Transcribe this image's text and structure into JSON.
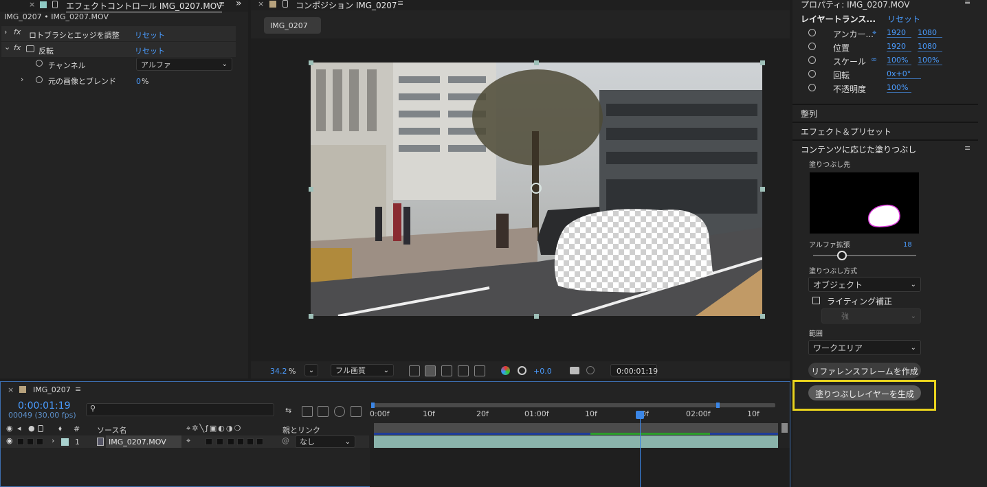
{
  "effect_panel": {
    "tab_label": "エフェクトコントロール IMG_0207.MOV",
    "breadcrumb": "IMG_0207 • IMG_0207.MOV",
    "rows": [
      {
        "fx": "fx",
        "label": "ロトブラシとエッジを調整",
        "value": "リセット"
      },
      {
        "fx": "fx",
        "label": "反転",
        "value": "リセット"
      }
    ],
    "channel_label": "チャンネル",
    "channel_value": "アルファ",
    "blend_label": "元の画像とブレンド",
    "blend_value": "0",
    "blend_unit": "%"
  },
  "comp_panel": {
    "tab_label": "コンポジション IMG_0207",
    "comp_chip": "IMG_0207",
    "toolbar": {
      "zoom": "34.2",
      "zoom_unit": "%",
      "quality": "フル画質",
      "exposure": "+0.0",
      "timecode": "0:00:01:19"
    }
  },
  "properties": {
    "title": "プロパティ: IMG_0207.MOV",
    "section": "レイヤートランス...",
    "reset": "リセット",
    "rows": [
      {
        "label": "アンカー...",
        "v1": "1920",
        "v2": "1080"
      },
      {
        "label": "位置",
        "v1": "1920",
        "v2": "1080"
      },
      {
        "label": "スケール",
        "v1": "100%",
        "v2": "100%"
      },
      {
        "label": "回転",
        "v1": "0x+0°",
        "v2": ""
      },
      {
        "label": "不透明度",
        "v1": "100%",
        "v2": ""
      }
    ],
    "align": "整列",
    "effects_presets": "エフェクト＆プリセット",
    "cafill": {
      "title": "コンテンツに応じた塗りつぶし",
      "target_label": "塗りつぶし先",
      "alpha_label": "アルファ拡張",
      "alpha_value": "18",
      "method_label": "塗りつぶし方式",
      "method_value": "オブジェクト",
      "lighting_label": "ライティング補正",
      "strength_value": "強",
      "range_label": "範囲",
      "range_value": "ワークエリア",
      "ref_button": "リファレンスフレームを作成",
      "generate_button": "塗りつぶしレイヤーを生成"
    }
  },
  "timeline": {
    "tab_label": "IMG_0207",
    "timecode": "0:00:01:19",
    "frames": "00049 (30.00 fps)",
    "search_placeholder": "",
    "ruler": [
      "0:00f",
      "10f",
      "20f",
      "01:00f",
      "10f",
      "20f",
      "02:00f",
      "10f"
    ],
    "header_hash": "#",
    "header_source": "ソース名",
    "header_parent": "親とリンク",
    "layer": {
      "num": "1",
      "name": "IMG_0207.MOV",
      "parent": "なし"
    }
  }
}
